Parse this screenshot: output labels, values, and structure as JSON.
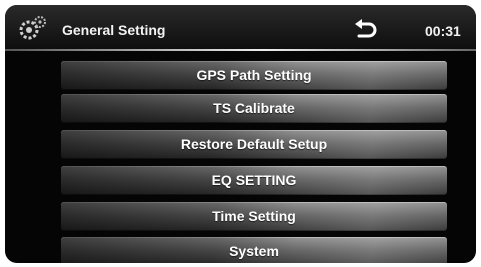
{
  "header": {
    "title": "General Setting",
    "time": "00:31",
    "back_icon": "back-arrow-icon",
    "settings_icon": "gear-settings-icon"
  },
  "menu": [
    {
      "label": "GPS Path Setting"
    },
    {
      "label": "TS Calibrate"
    },
    {
      "label": "Restore Default Setup"
    },
    {
      "label": "EQ SETTING"
    },
    {
      "label": "Time Setting"
    },
    {
      "label": "System"
    }
  ]
}
